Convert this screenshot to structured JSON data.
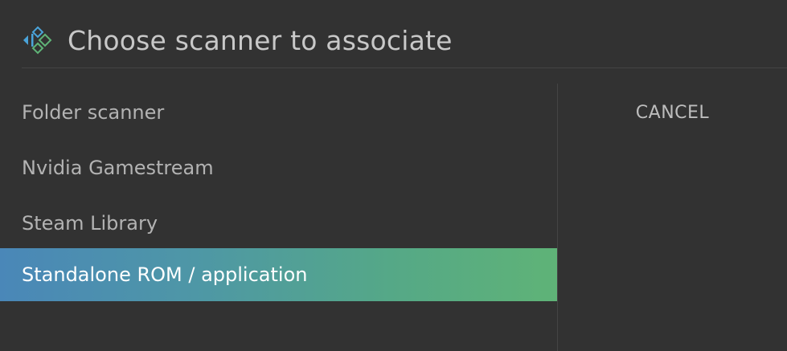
{
  "dialog": {
    "title": "Choose scanner to associate",
    "logo_icon": "kodi-logo-icon"
  },
  "scanners": [
    {
      "label": "Folder scanner",
      "selected": false
    },
    {
      "label": "Nvidia Gamestream",
      "selected": false
    },
    {
      "label": "Steam Library",
      "selected": false
    },
    {
      "label": "Standalone ROM / application",
      "selected": true
    }
  ],
  "actions": {
    "cancel_label": "CANCEL"
  },
  "colors": {
    "background": "#323232",
    "selection_start": "#4a87b8",
    "selection_end": "#5fb377",
    "logo_blue": "#4aa3d9",
    "logo_green": "#5fb377"
  }
}
